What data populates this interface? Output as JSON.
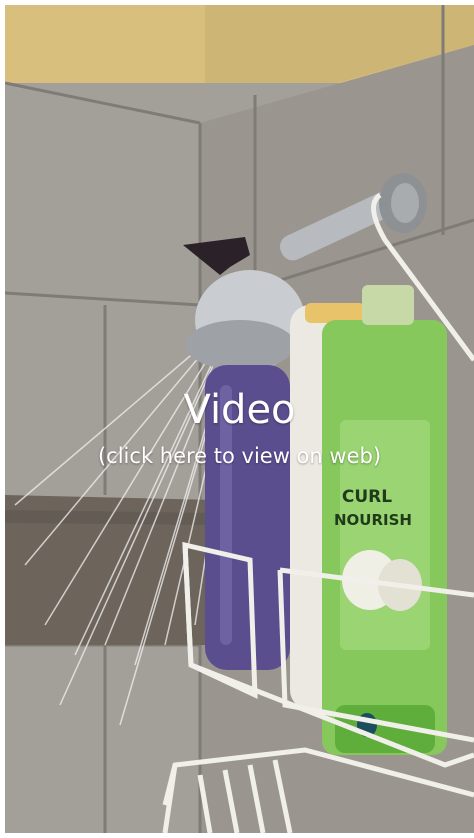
{
  "video": {
    "title": "Video",
    "subtitle": "(click here to view on web)"
  },
  "product_label": {
    "line1": "CURL",
    "line2": "NOURISH"
  },
  "colors": {
    "wall_yellow": "#d8bf7e",
    "tile": "#a39f99",
    "grout": "#7f7b76",
    "accent_stripe": "#6d655c",
    "chrome": "#c9ccd0",
    "green_bottle": "#86c85c",
    "purple_bottle": "#5b4e8f",
    "white_bottle": "#ece9e2",
    "caddy_wire": "#f1efea",
    "overlay_text": "#ffffff"
  }
}
